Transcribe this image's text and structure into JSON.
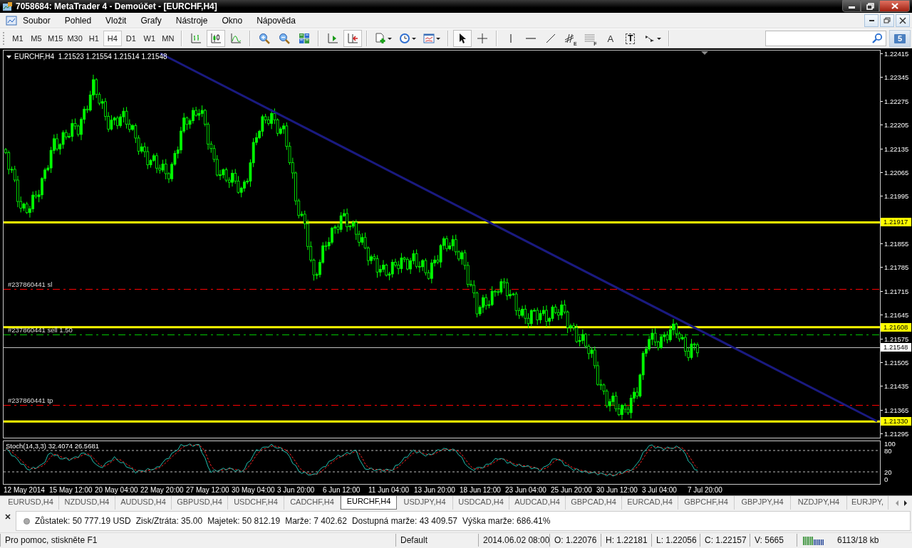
{
  "window": {
    "title": "7058684: MetaTrader 4 - Demoúčet - [EURCHF,H4]"
  },
  "menu": [
    "Soubor",
    "Pohled",
    "Vložit",
    "Grafy",
    "Nástroje",
    "Okno",
    "Nápověda"
  ],
  "toolbar": {
    "timeframes": [
      {
        "label": "M1",
        "selected": false
      },
      {
        "label": "M5",
        "selected": false
      },
      {
        "label": "M15",
        "selected": false
      },
      {
        "label": "M30",
        "selected": false
      },
      {
        "label": "H1",
        "selected": false
      },
      {
        "label": "H4",
        "selected": true
      },
      {
        "label": "D1",
        "selected": false
      },
      {
        "label": "W1",
        "selected": false
      },
      {
        "label": "MN",
        "selected": false
      }
    ],
    "chart_types": [
      {
        "kind": "bars",
        "selected": false
      },
      {
        "kind": "candles",
        "selected": true
      },
      {
        "kind": "line",
        "selected": false
      }
    ],
    "chart_shift": false,
    "auto_scroll": true,
    "pointer_tools": [
      {
        "kind": "cursor",
        "selected": true
      },
      {
        "kind": "crosshair",
        "selected": false
      }
    ],
    "line_tools": [
      {
        "kind": "vline"
      },
      {
        "kind": "hline"
      },
      {
        "kind": "trend"
      },
      {
        "kind": "channel",
        "glyph": "E"
      },
      {
        "kind": "fibo",
        "glyph": "F"
      },
      {
        "kind": "text",
        "glyph": "A"
      },
      {
        "kind": "label",
        "glyph": "T"
      },
      {
        "kind": "arrows"
      }
    ],
    "notifications": "5"
  },
  "chart": {
    "header": "EURCHF,H4  1.21523 1.21554 1.21514 1.21548",
    "price_ticks": [
      "1.22415",
      "1.22345",
      "1.22275",
      "1.22205",
      "1.22135",
      "1.22065",
      "1.21995",
      "1.21855",
      "1.21785",
      "1.21715",
      "1.21645",
      "1.21575",
      "1.21505",
      "1.21435",
      "1.21365",
      "1.21295"
    ],
    "lines": [
      {
        "kind": "level",
        "price": "1.21917",
        "color": "#ffff00"
      },
      {
        "kind": "level",
        "price": "1.21608",
        "color": "#ffff00"
      },
      {
        "kind": "bid",
        "price": "1.21548",
        "color": "#c0c0c0"
      },
      {
        "kind": "level",
        "price": "1.21330",
        "color": "#ffff00"
      }
    ],
    "orders": [
      {
        "label": "#237860441 sl",
        "color": "#ff0000"
      },
      {
        "label": "#237860441 sell 1.50",
        "color": "#00c800"
      },
      {
        "label": "#237860441 tp",
        "color": "#ff0000"
      }
    ],
    "indicator": {
      "label": "Stoch(14,3,3) 32.4074 26.5681",
      "scale": [
        "100",
        "80",
        "20",
        "0"
      ]
    },
    "time_labels": [
      "12 May 2014",
      "15 May 12:00",
      "20 May 04:00",
      "22 May 20:00",
      "27 May 12:00",
      "30 May 04:00",
      "3 Jun 20:00",
      "6 Jun 12:00",
      "11 Jun 04:00",
      "13 Jun 20:00",
      "18 Jun 12:00",
      "23 Jun 04:00",
      "25 Jun 20:00",
      "30 Jun 12:00",
      "3 Jul 04:00",
      "7 Jul 20:00"
    ]
  },
  "tabs": [
    {
      "label": "EURUSD,H4",
      "selected": false
    },
    {
      "label": "NZDUSD,H4",
      "selected": false
    },
    {
      "label": "AUDUSD,H4",
      "selected": false
    },
    {
      "label": "GBPUSD,H4",
      "selected": false
    },
    {
      "label": "USDCHF,H4",
      "selected": false
    },
    {
      "label": "CADCHF,H4",
      "selected": false
    },
    {
      "label": "EURCHF,H4",
      "selected": true
    },
    {
      "label": "USDJPY,H4",
      "selected": false
    },
    {
      "label": "USDCAD,H4",
      "selected": false
    },
    {
      "label": "AUDCAD,H4",
      "selected": false
    },
    {
      "label": "GBPCAD,H4",
      "selected": false
    },
    {
      "label": "EURCAD,H4",
      "selected": false
    },
    {
      "label": "GBPCHF,H4",
      "selected": false
    },
    {
      "label": "GBPJPY,H4",
      "selected": false
    },
    {
      "label": "NZDJPY,H4",
      "selected": false
    },
    {
      "label": "EURJPY,",
      "selected": false
    }
  ],
  "account": {
    "items": [
      "Zůstatek: 50 777.19 USD",
      "Zisk/Ztráta: 35.00",
      "Majetek: 50 812.19",
      "Marže: 7 402.62",
      "Dostupná marže: 43 409.57",
      "Výška marže: 686.41%"
    ]
  },
  "status_bar": {
    "help": "Pro pomoc, stiskněte F1",
    "profile": "Default",
    "time": "2014.06.02 08:00",
    "open": "O: 1.22076",
    "high": "H: 1.22181",
    "low": "L: 1.22056",
    "close": "C: 1.22157",
    "volume": "V: 5665",
    "traffic": "6113/18 kb"
  }
}
